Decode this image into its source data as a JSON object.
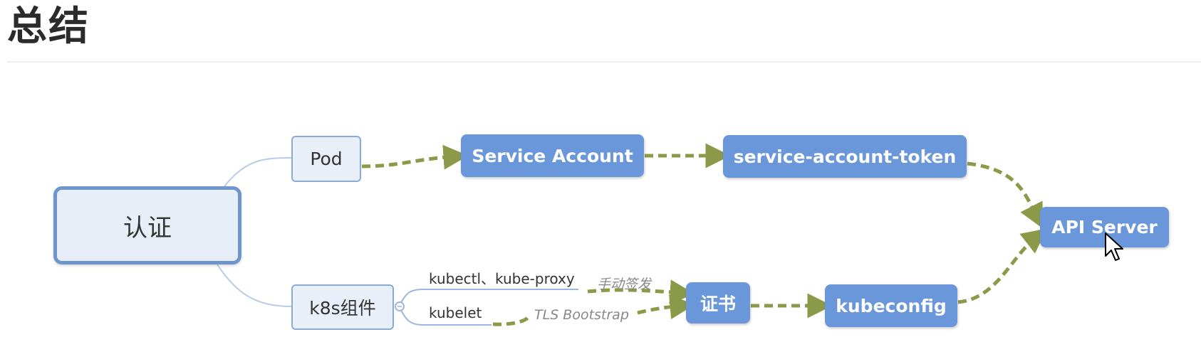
{
  "page": {
    "title": "总结"
  },
  "diagram": {
    "root": "认证",
    "pod": "Pod",
    "k8s_components": "k8s组件",
    "service_account": "Service Account",
    "service_account_token": "service-account-token",
    "api_server": "API Server",
    "certificate": "证书",
    "kubeconfig": "kubeconfig",
    "branch_kubectl": "kubectl、kube-proxy",
    "branch_kubelet": "kubelet",
    "edge_manual": "手动签发",
    "edge_tls": "TLS Bootstrap"
  },
  "colors": {
    "node_fill": "#6a97d9",
    "light_node_fill": "#e9eff9",
    "light_node_border": "#8aabd8",
    "arrow": "#8a9a48",
    "tree_line": "#b9cbe6"
  }
}
